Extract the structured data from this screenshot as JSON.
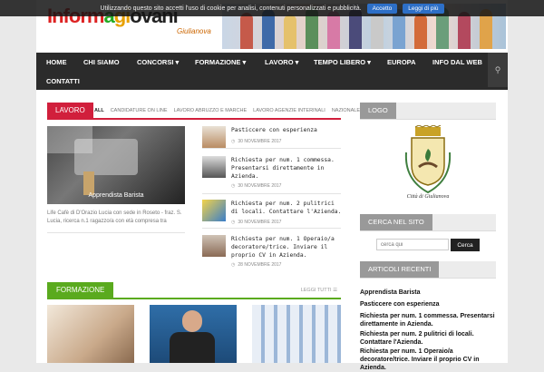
{
  "cookie": {
    "text": "Utilizzando questo sito accetti l'uso di cookie per analisi, contenuti personalizzati e pubblicità.",
    "accept": "Accetto",
    "more": "Leggi di più"
  },
  "header": {
    "logo_parts": [
      "Inform",
      "a",
      "gi",
      "ovani"
    ],
    "logo_sub": "Giulianova"
  },
  "nav": {
    "items": [
      "HOME",
      "CHI SIAMO",
      "CONCORSI ▾",
      "FORMAZIONE ▾",
      "LAVORO ▾",
      "TEMPO LIBERO ▾",
      "EUROPA",
      "INFO DAL WEB",
      "CONTATTI"
    ],
    "search_icon": "search-icon"
  },
  "lavoro": {
    "title": "LAVORO",
    "tabs": [
      "ALL",
      "CANDIDATURE ON LINE",
      "LAVORO ABRUZZO E MARCHE",
      "LAVORO AGENZIE INTERINALI",
      "NAZIONALE"
    ],
    "featured": {
      "caption": "Apprendista Barista",
      "excerpt": "Life Cafè di D'Orazio Lucia con sede in Roseto - fraz. S. Lucia, ricerca n.1 ragazzo/a con età compresa tra"
    },
    "items": [
      {
        "title": "Pasticcere con esperienza",
        "date": "30 NOVEMBRE 2017"
      },
      {
        "title": "Richiesta per num. 1 commessa. Presentarsi direttamente in Azienda.",
        "date": "30 NOVEMBRE 2017"
      },
      {
        "title": "Richiesta per num. 2 pulitrici di locali. Contattare l'Azienda.",
        "date": "30 NOVEMBRE 2017"
      },
      {
        "title": "Richiesta per num. 1 Operaio/a decoratore/trice. Inviare il proprio CV in Azienda.",
        "date": "28 NOVEMBRE 2017"
      }
    ]
  },
  "formazione": {
    "title": "FORMAZIONE",
    "more": "LEGGI TUTTI"
  },
  "sidebar": {
    "logo_title": "LOGO",
    "crest_name": "Città di Giulianova",
    "search_title": "CERCA NEL SITO",
    "search_placeholder": "cerca qui",
    "search_button": "Cerca",
    "recent_title": "ARTICOLI RECENTI",
    "recent": [
      "Apprendista Barista",
      "Pasticcere con esperienza",
      "Richiesta per num. 1 commessa. Presentarsi direttamente in Azienda.",
      "Richiesta per num. 2 pulitrici di locali. Contattare l'Azienda.",
      "Richiesta per num. 1 Operaio/a decoratore/trice. Inviare il proprio CV in Azienda."
    ]
  },
  "colors": {
    "lavoro_accent": "#d11f3c",
    "formazione_accent": "#5aaa1e",
    "nav_bg": "#2b2b2b",
    "sidebar_tag": "#999999"
  }
}
